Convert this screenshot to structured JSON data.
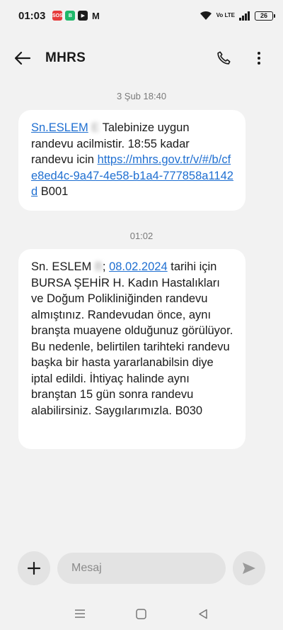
{
  "status_bar": {
    "time": "01:03",
    "notifications": [
      {
        "icon": "sos-icon",
        "label": "SOS"
      },
      {
        "icon": "app-notification-icon",
        "label": "B"
      },
      {
        "icon": "youtube-icon",
        "label": "▶"
      },
      {
        "icon": "gmail-icon",
        "label": "M"
      }
    ],
    "volte": "Vo LTE",
    "battery": "26"
  },
  "header": {
    "title": "MHRS",
    "back_icon": "arrow-left-icon",
    "call_icon": "phone-icon",
    "menu_icon": "more-vertical-icon"
  },
  "conversation": [
    {
      "date": "3 Şub 18:40",
      "segments": [
        {
          "text": "Sn.ESLEM",
          "link": true
        },
        {
          "text": " "
        },
        {
          "text": "E",
          "redacted": true
        },
        {
          "text": " Talebinize uygun randevu acilmistir. 18:55 kadar randevu icin "
        },
        {
          "text": "https://mhrs.gov.tr/v/#/b/cfe8ed4c-9a47-4e58-b1a4-777858a1142d",
          "link": true
        },
        {
          "text": " B001"
        }
      ]
    },
    {
      "date": "01:02",
      "segments": [
        {
          "text": "Sn. ESLEM "
        },
        {
          "text": "B",
          "redacted": true
        },
        {
          "text": "; "
        },
        {
          "text": "08.02.2024",
          "link": true
        },
        {
          "text": " tarihi için BURSA ŞEHİR H. Kadın Hastalıkları ve Doğum Polikliniğinden randevu almıştınız. Randevudan önce, aynı branşta muayene olduğunuz görülüyor. Bu nedenle, belirtilen tarihteki randevu başka bir hasta yararlanabilsin diye iptal edildi. İhtiyaç halinde aynı branştan 15 gün sonra randevu alabilirsiniz. Saygılarımızla. B030"
        }
      ]
    }
  ],
  "composer": {
    "add_icon": "plus-icon",
    "placeholder": "Mesaj",
    "value": "",
    "send_icon": "send-icon"
  },
  "navigation": {
    "items": [
      "recents-icon",
      "home-icon",
      "back-triangle-icon"
    ]
  },
  "colors": {
    "background": "#f2f2f2",
    "bubble": "#ffffff",
    "link": "#1f6fd1",
    "date_text": "#7a7a7a"
  }
}
